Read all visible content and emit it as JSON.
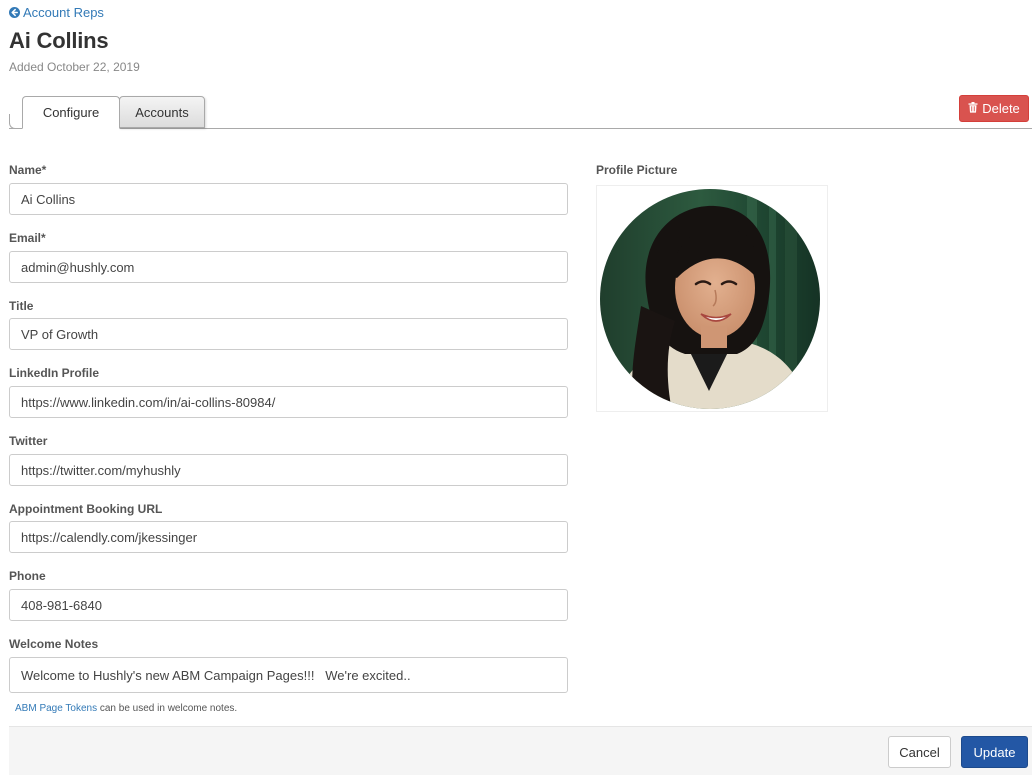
{
  "breadcrumb": {
    "back_label": "Account Reps",
    "icon": "arrow-circle-left-icon"
  },
  "header": {
    "title": "Ai Collins",
    "subtitle": "Added October 22, 2019"
  },
  "tabs": [
    {
      "label": "Configure",
      "active": true
    },
    {
      "label": "Accounts",
      "active": false
    }
  ],
  "actions": {
    "delete_label": "Delete",
    "delete_icon": "trash-icon",
    "delete_color": "#d9534f"
  },
  "form": {
    "fields": [
      {
        "label": "Name*",
        "value": "Ai Collins"
      },
      {
        "label": "Email*",
        "value": "admin@hushly.com"
      },
      {
        "label": "Title",
        "value": "VP of Growth"
      },
      {
        "label": "LinkedIn Profile",
        "value": "https://www.linkedin.com/in/ai-collins-80984/"
      },
      {
        "label": "Twitter",
        "value": "https://twitter.com/myhushly"
      },
      {
        "label": "Appointment Booking URL",
        "value": "https://calendly.com/jkessinger"
      },
      {
        "label": "Phone",
        "value": "408-981-6840"
      },
      {
        "label": "Welcome Notes",
        "value": "Welcome to Hushly's new ABM Campaign Pages!!!   We're excited.."
      }
    ],
    "help": {
      "link_label": "ABM Page Tokens",
      "text": " can be used in welcome notes."
    }
  },
  "profile_picture": {
    "label": "Profile Picture"
  },
  "footer": {
    "cancel_label": "Cancel",
    "update_label": "Update",
    "update_color": "#2357a5"
  }
}
